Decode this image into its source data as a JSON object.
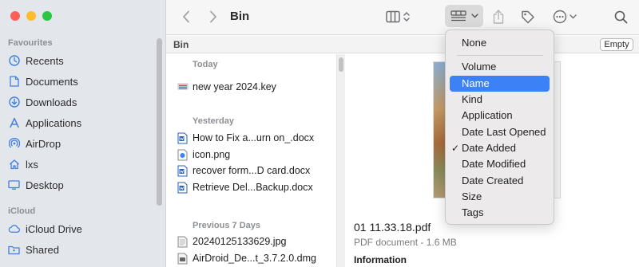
{
  "window": {
    "title": "Bin"
  },
  "sidebar": {
    "favourites_label": "Favourites",
    "favourites": [
      {
        "label": "Recents",
        "icon": "clock-icon"
      },
      {
        "label": "Documents",
        "icon": "document-icon"
      },
      {
        "label": "Downloads",
        "icon": "download-icon"
      },
      {
        "label": "Applications",
        "icon": "applications-icon"
      },
      {
        "label": "AirDrop",
        "icon": "airdrop-icon"
      },
      {
        "label": "lxs",
        "icon": "home-icon"
      },
      {
        "label": "Desktop",
        "icon": "desktop-icon"
      }
    ],
    "icloud_label": "iCloud",
    "icloud": [
      {
        "label": "iCloud Drive",
        "icon": "cloud-icon"
      },
      {
        "label": "Shared",
        "icon": "shared-folder-icon"
      }
    ]
  },
  "pathbar": {
    "title": "Bin",
    "empty_label": "Empty"
  },
  "filelist": {
    "groups": [
      {
        "label": "Today",
        "items": [
          {
            "name": "new year 2024.key",
            "icon": "keynote-icon"
          }
        ]
      },
      {
        "label": "Yesterday",
        "items": [
          {
            "name": "How to Fix a...urn on_.docx",
            "icon": "word-doc-icon"
          },
          {
            "name": "icon.png",
            "icon": "png-image-icon"
          },
          {
            "name": "recover form...D card.docx",
            "icon": "word-doc-icon"
          },
          {
            "name": "Retrieve Del...Backup.docx",
            "icon": "word-doc-icon"
          }
        ]
      },
      {
        "label": "Previous 7 Days",
        "items": [
          {
            "name": "20240125133629.jpg",
            "icon": "jpg-image-icon"
          },
          {
            "name": "AirDroid_De...t_3.7.2.0.dmg",
            "icon": "disk-image-icon"
          }
        ]
      }
    ]
  },
  "preview": {
    "filename": "01 11.33.18.pdf",
    "meta": "PDF document - 1.6 MB",
    "info_heading": "Information"
  },
  "sort_menu": {
    "items": [
      {
        "label": "None",
        "checked": false,
        "highlighted": false
      },
      {
        "label": "Volume",
        "checked": false,
        "highlighted": false
      },
      {
        "label": "Name",
        "checked": false,
        "highlighted": true
      },
      {
        "label": "Kind",
        "checked": false,
        "highlighted": false
      },
      {
        "label": "Application",
        "checked": false,
        "highlighted": false
      },
      {
        "label": "Date Last Opened",
        "checked": false,
        "highlighted": false
      },
      {
        "label": "Date Added",
        "checked": true,
        "highlighted": false
      },
      {
        "label": "Date Modified",
        "checked": false,
        "highlighted": false
      },
      {
        "label": "Date Created",
        "checked": false,
        "highlighted": false
      },
      {
        "label": "Size",
        "checked": false,
        "highlighted": false
      },
      {
        "label": "Tags",
        "checked": false,
        "highlighted": false
      }
    ],
    "check_mark": "✓"
  },
  "colors": {
    "accent": "#3c82f6",
    "sidebar_icon": "#3f7fe0",
    "close": "#fe5f57",
    "minimize": "#febc2e",
    "zoom": "#28c840"
  }
}
